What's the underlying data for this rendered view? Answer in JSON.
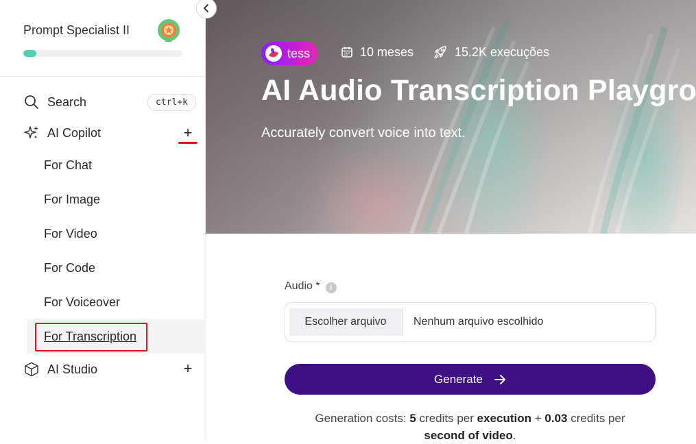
{
  "sidebar": {
    "profile": {
      "title": "Prompt Specialist II",
      "progress": 0.08
    },
    "search": {
      "label": "Search",
      "shortcut": "ctrl+k"
    },
    "copilot": {
      "label": "AI Copilot",
      "toggle": "+",
      "items": [
        {
          "label": "For Chat"
        },
        {
          "label": "For Image"
        },
        {
          "label": "For Video"
        },
        {
          "label": "For Code"
        },
        {
          "label": "For Voiceover"
        },
        {
          "label": "For Transcription"
        }
      ]
    },
    "studio": {
      "label": "AI Studio",
      "toggle": "+"
    }
  },
  "hero": {
    "tag": "tess",
    "age": "10 meses",
    "executions": "15.2K execuções",
    "title": "AI Audio Transcription Playground",
    "subtitle": "Accurately convert voice into text."
  },
  "form": {
    "audio_label": "Audio *",
    "info_glyph": "i",
    "file_button": "Escolher arquivo",
    "file_status": "Nenhum arquivo escolhido",
    "generate": "Generate"
  },
  "cost": {
    "prefix": "Generation costs:",
    "execution_credits": "5",
    "mid1": "credits per",
    "execution": "execution",
    "plus": "+",
    "second_credits": "0.03",
    "mid2": "credits per",
    "second": "second of video",
    "end": "."
  },
  "colors": {
    "accent": "#3d0f82",
    "progress": "#4fd0b0",
    "highlight": "#e0161b",
    "tag_from": "#8b1cf5",
    "tag_to": "#e826b8"
  }
}
